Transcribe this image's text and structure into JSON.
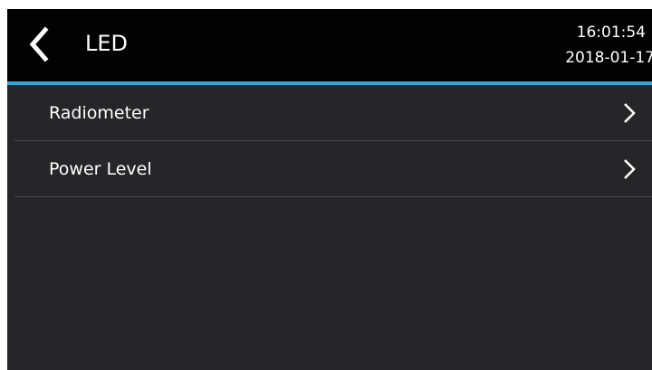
{
  "header": {
    "back_icon": "chevron-left-icon",
    "title": "LED",
    "time": "16:01:54",
    "date": "2018-01-17"
  },
  "menu": {
    "items": [
      {
        "label": "Radiometer",
        "icon": "chevron-right-icon"
      },
      {
        "label": "Power Level",
        "icon": "chevron-right-icon"
      }
    ]
  },
  "colors": {
    "header_background": "#020202",
    "accent_line": "#33a8d8",
    "screen_background": "#262528",
    "divider": "#4a494d",
    "text": "#ffffff"
  }
}
